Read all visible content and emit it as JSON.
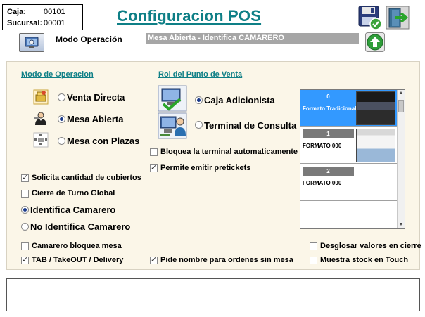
{
  "header": {
    "caja_label": "Caja:",
    "caja_value": "00101",
    "sucursal_label": "Sucursal:",
    "sucursal_value": "00001",
    "title": "Configuracion POS"
  },
  "mode_row": {
    "label": "Modo Operación",
    "value": "Mesa Abierta - Identifica CAMARERO"
  },
  "modo_operacion": {
    "title": "Modo de Operacion",
    "options": [
      {
        "label": "Venta Directa",
        "selected": false,
        "icon": "cashier-icon"
      },
      {
        "label": "Mesa Abierta",
        "selected": true,
        "icon": "waiter-icon"
      },
      {
        "label": "Mesa con Plazas",
        "selected": false,
        "icon": "table-seats-icon"
      }
    ]
  },
  "rol_punto_venta": {
    "title": "Rol del Punto de Venta",
    "options": [
      {
        "label": "Caja Adicionista",
        "selected": true,
        "icon": "computer-check-icon"
      },
      {
        "label": "Terminal de Consulta",
        "selected": false,
        "icon": "computer-user-icon"
      }
    ],
    "bloquea_label": "Bloquea la terminal automaticamente",
    "bloquea_checked": false,
    "pretickets_label": "Permite emitir pretickets",
    "pretickets_checked": true
  },
  "options_left": {
    "cubiertos_label": "Solicita cantidad de cubiertos",
    "cubiertos_checked": true,
    "cierre_label": "Cierre de Turno Global",
    "cierre_checked": false,
    "identifica_label": "Identifica Camarero",
    "identifica_selected": true,
    "no_identifica_label": "No Identifica Camarero",
    "no_identifica_selected": false
  },
  "bottom_options": {
    "camarero_bloquea_label": "Camarero bloquea mesa",
    "camarero_bloquea_checked": false,
    "tab_label": "TAB / TakeOUT / Delivery",
    "tab_checked": true,
    "pide_nombre_label": "Pide nombre para ordenes sin mesa",
    "pide_nombre_checked": true,
    "desglosar_label": "Desglosar valores en cierre",
    "desglosar_checked": false,
    "muestra_stock_label": "Muestra stock en Touch",
    "muestra_stock_checked": false
  },
  "formats": [
    {
      "number": "0",
      "name": "Formato Tradicional",
      "selected": true
    },
    {
      "number": "1",
      "name": "FORMATO 000",
      "selected": false
    },
    {
      "number": "2",
      "name": "FORMATO 000",
      "selected": false
    }
  ],
  "colors": {
    "title": "#0e7f86",
    "panel_bg": "#fbf6e8",
    "selected_format": "#3399ff",
    "mode_value_bg": "#a6a6a6"
  }
}
